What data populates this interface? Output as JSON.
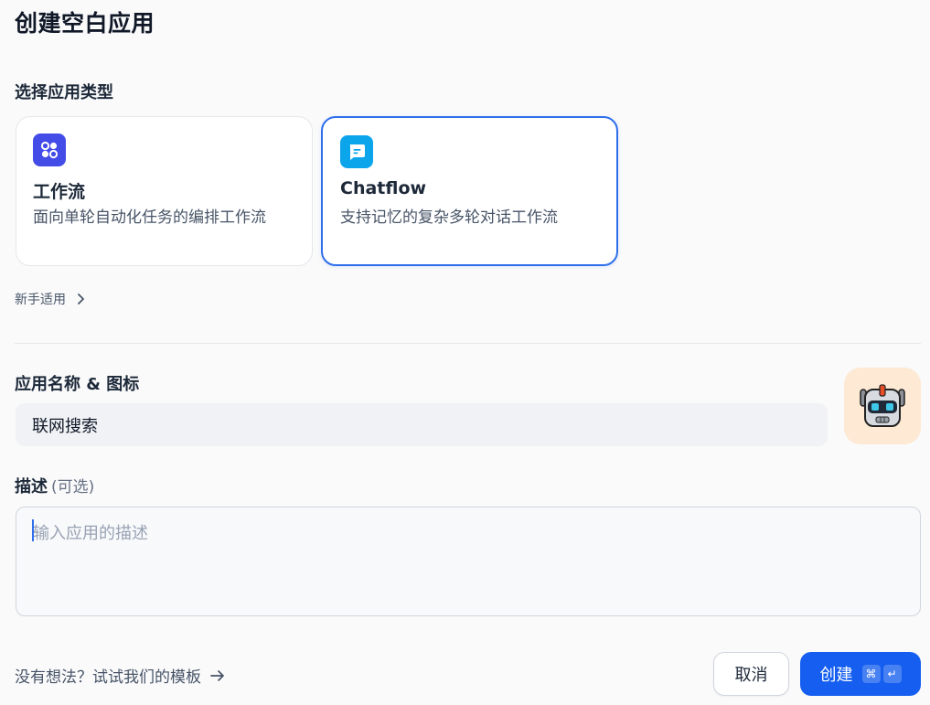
{
  "header": {
    "title": "创建空白应用"
  },
  "app_type": {
    "label": "选择应用类型",
    "cards": [
      {
        "title": "工作流",
        "desc": "面向单轮自动化任务的编排工作流",
        "icon": "workflow-icon",
        "color": "#444ce7"
      },
      {
        "title": "Chatflow",
        "desc": "支持记忆的复杂多轮对话工作流",
        "icon": "chat-bubble-icon",
        "color": "#0ba5ec"
      }
    ],
    "beginner_label": "新手适用"
  },
  "name_section": {
    "label": "应用名称 & 图标",
    "value": "联网搜索",
    "avatar": "robot-icon"
  },
  "description": {
    "label": "描述",
    "optional": "(可选)",
    "placeholder": "输入应用的描述"
  },
  "footer": {
    "template_link": "没有想法？试试我们的模板",
    "cancel": "取消",
    "create": "创建",
    "shortcut_cmd": "⌘",
    "shortcut_enter": "↵"
  },
  "colors": {
    "accent": "#155eef",
    "selected_border": "#2f6feb"
  }
}
